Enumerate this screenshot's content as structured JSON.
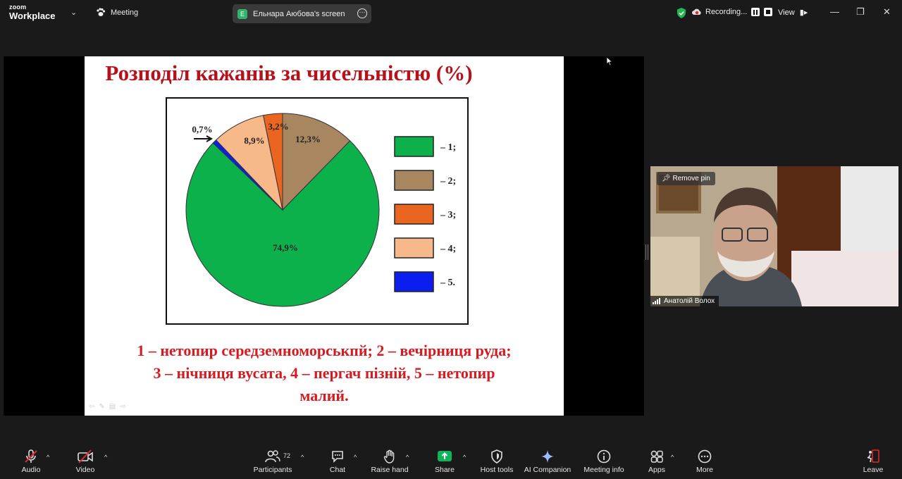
{
  "app": {
    "logo_top": "zoom",
    "logo_bottom": "Workplace",
    "meeting_label": "Meeting"
  },
  "share": {
    "badge": "E",
    "label": "Ельнара Аюбова's screen"
  },
  "recording": {
    "label": "Recording..."
  },
  "view": {
    "label": "View"
  },
  "slide": {
    "title": "Розподіл кажанів за чисельністю (%)",
    "caption_line1": "1 – нетопир середземноморськпй; 2 – вечірниця руда;",
    "caption_line2": "3 – нічниця вусата, 4 – пергач пізній, 5 – нетопир",
    "caption_line3": "малий."
  },
  "chart_data": {
    "type": "pie",
    "slices": [
      {
        "legend": "– 1;",
        "value": 74.9,
        "label": "74,9%",
        "color": "#0db14b"
      },
      {
        "legend": "– 2;",
        "value": 12.3,
        "label": "12,3%",
        "color": "#a8865f"
      },
      {
        "legend": "– 3;",
        "value": 3.2,
        "label": "3,2%",
        "color": "#ea6620"
      },
      {
        "legend": "– 4;",
        "value": 8.9,
        "label": "8,9%",
        "color": "#f7b98a"
      },
      {
        "legend": "– 5.",
        "value": 0.7,
        "label": "0,7%",
        "color": "#0a1ef0"
      }
    ]
  },
  "video": {
    "remove_pin": "Remove pin",
    "participant_name": "Анатолій Волох"
  },
  "toolbar": {
    "audio": "Audio",
    "video": "Video",
    "participants": "Participants",
    "participant_count": "72",
    "chat": "Chat",
    "raise_hand": "Raise hand",
    "share": "Share",
    "host_tools": "Host tools",
    "ai_companion": "AI Companion",
    "meeting_info": "Meeting info",
    "apps": "Apps",
    "more": "More",
    "leave": "Leave"
  },
  "colors": {
    "share_green": "#0fb35a",
    "leave_red": "#e02828",
    "title_red": "#b5121b",
    "caption_red": "#d71920"
  }
}
